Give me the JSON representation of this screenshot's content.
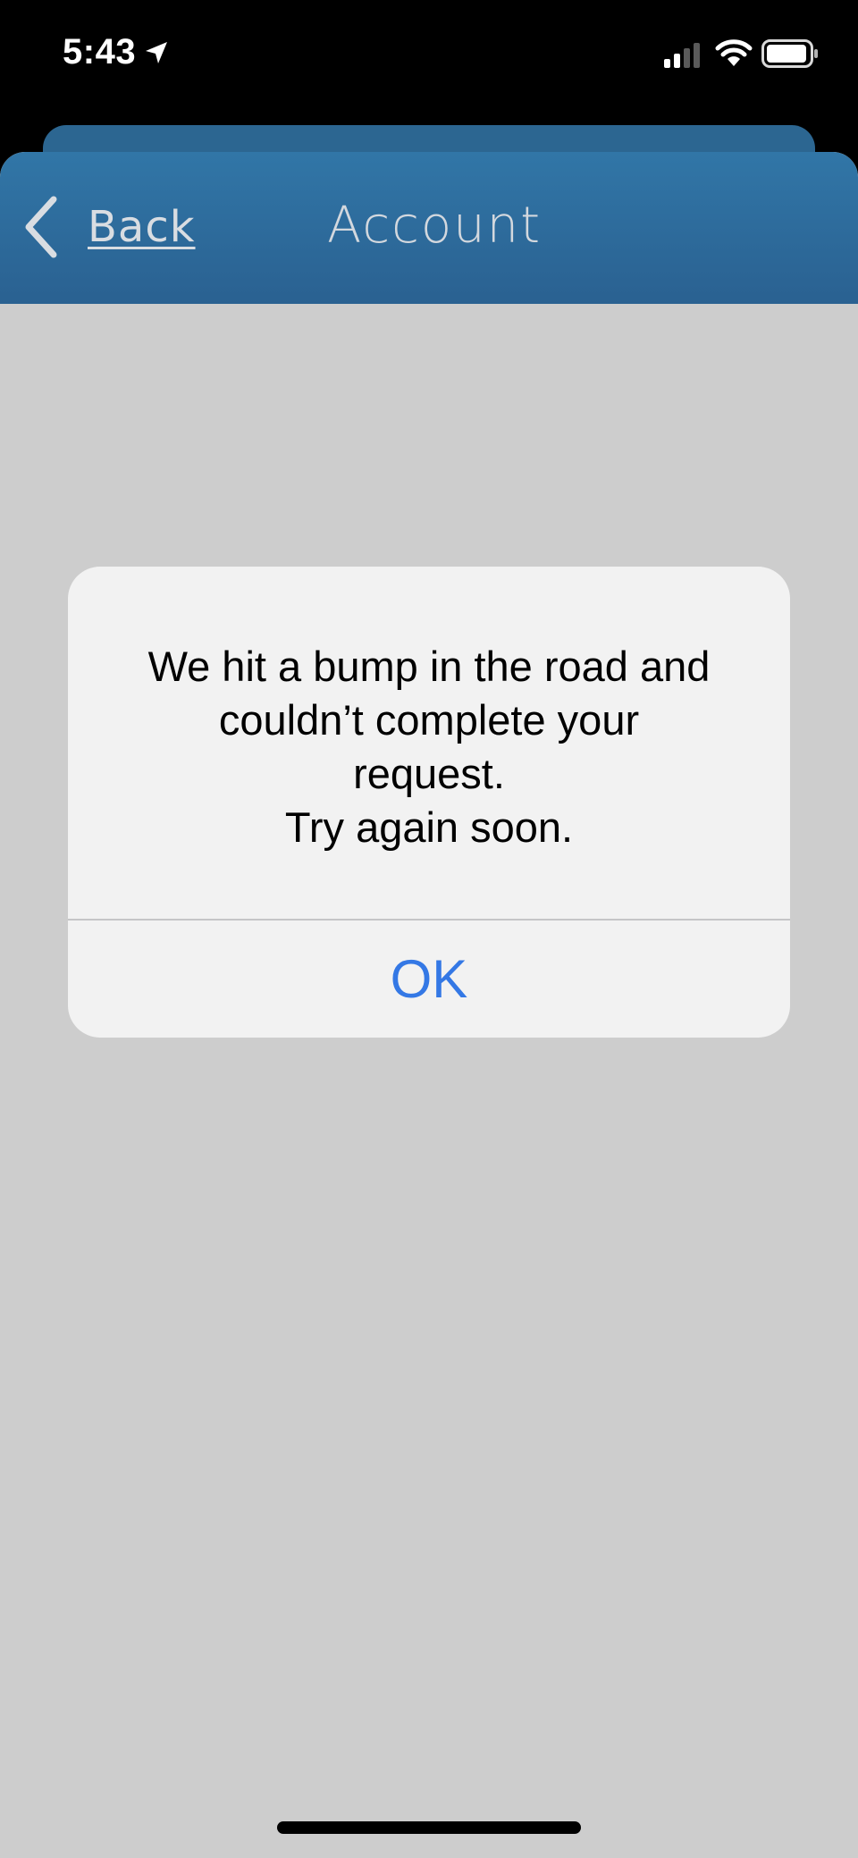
{
  "status_bar": {
    "time": "5:43",
    "icons": [
      "location-arrow-icon",
      "cellular-signal-icon",
      "wifi-icon",
      "battery-icon"
    ]
  },
  "nav": {
    "back_label": "Back",
    "back_icon": "chevron-left-icon",
    "title": "Account"
  },
  "alert": {
    "message": "We hit a bump in the road and\ncouldn’t complete your\nrequest.\nTry again soon.",
    "ok_label": "OK"
  },
  "colors": {
    "nav_bar": "#2e6c9c",
    "background": "#cdcdcd",
    "alert_background": "#f2f2f2",
    "ok_button": "#3478e5"
  }
}
